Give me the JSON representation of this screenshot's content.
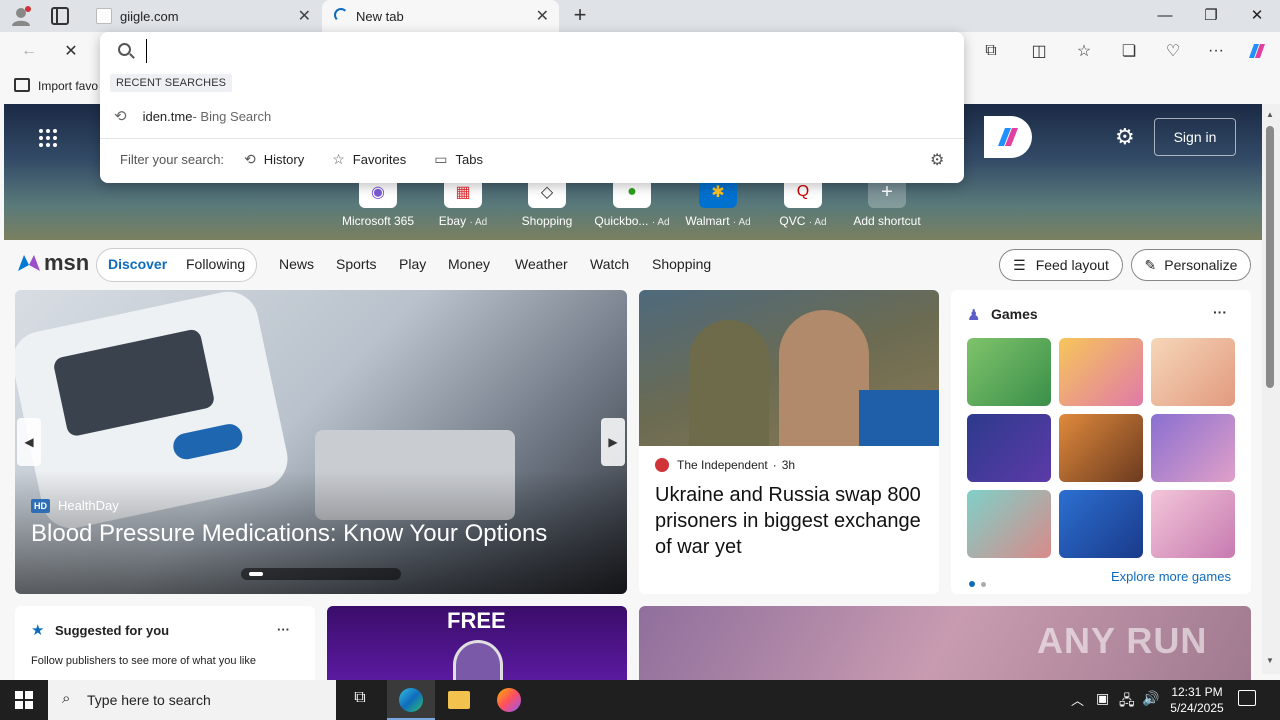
{
  "browser": {
    "tabs": [
      {
        "label": "giigle.com"
      },
      {
        "label": "New tab"
      }
    ],
    "new_tab_symbol": "+",
    "window_controls": {
      "minimize": "—",
      "restore": "❐",
      "close": "✕"
    },
    "favorites_bar": {
      "import_label": "Import favo"
    }
  },
  "address_dropdown": {
    "input_value": "",
    "recent_header": "RECENT SEARCHES",
    "recent_items": [
      {
        "query": "iden.tme",
        "suffix": " - Bing Search"
      }
    ],
    "filter_label": "Filter your search:",
    "filters": [
      {
        "label": "History",
        "icon": "history-icon"
      },
      {
        "label": "Favorites",
        "icon": "star-icon"
      },
      {
        "label": "Tabs",
        "icon": "tabs-icon"
      }
    ]
  },
  "newtab": {
    "sign_in_label": "Sign in",
    "shortcuts": [
      {
        "label": "Microsoft 365",
        "ad": ""
      },
      {
        "label": "Ebay",
        "ad": "· Ad"
      },
      {
        "label": "Shopping",
        "ad": ""
      },
      {
        "label": "Quickbo...",
        "ad": "· Ad"
      },
      {
        "label": "Walmart",
        "ad": "· Ad"
      },
      {
        "label": "QVC",
        "ad": "· Ad"
      },
      {
        "label": "Add shortcut",
        "ad": ""
      }
    ],
    "msn": {
      "logo_text": "msn",
      "primary_tabs": [
        "Discover",
        "Following"
      ],
      "nav": [
        "News",
        "Sports",
        "Play",
        "Money",
        "Weather",
        "Watch",
        "Shopping"
      ],
      "feed_layout_label": "Feed layout",
      "personalize_label": "Personalize"
    },
    "hero": {
      "source": "HealthDay",
      "source_badge": "HD",
      "title": "Blood Pressure Medications: Know Your Options"
    },
    "news_card": {
      "source": "The Independent",
      "age": "3h",
      "headline": "Ukraine and Russia swap 800 prisoners in biggest exchange of war yet"
    },
    "games": {
      "title": "Games",
      "more": "···",
      "explore": "Explore more games"
    },
    "suggested": {
      "title": "Suggested for you",
      "more": "···",
      "body": "Follow publishers to see more of what you like"
    },
    "promo": {
      "label": "FREE"
    },
    "watermark": "ANY RUN"
  },
  "taskbar": {
    "search_placeholder": "Type here to search",
    "time": "12:31 PM",
    "date": "5/24/2025"
  },
  "colors": {
    "accent": "#0f6cbd",
    "taskbar": "#1f1f1f",
    "title_bar": "#dfe3e8"
  }
}
